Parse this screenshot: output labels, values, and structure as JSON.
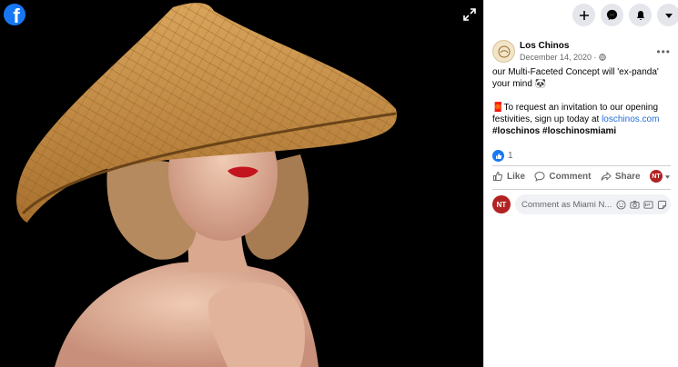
{
  "app": {
    "logo_letter": "f"
  },
  "topbar": {
    "icons": [
      "plus-icon",
      "messenger-icon",
      "bell-icon",
      "caret-down-icon"
    ]
  },
  "post": {
    "page_name": "Los Chinos",
    "date": "December 14, 2020 ·",
    "line1": "our Multi-Faceted Concept will 'ex-panda' your mind 🐼",
    "line2_prefix": "🧧To request an invitation to our opening festivities, sign up today at ",
    "link": "loschinos.com",
    "hashtag1": "#loschinos",
    "hashtag2": "#loschinosmiami",
    "reaction_count": "1"
  },
  "actions": {
    "like": "Like",
    "comment": "Comment",
    "share": "Share",
    "profile_initials": "NT"
  },
  "comment": {
    "avatar_initials": "NT",
    "placeholder": "Comment as Miami N..."
  },
  "colors": {
    "brand": "#1877f2",
    "link": "#216fdb",
    "badge_red": "#b22222"
  }
}
